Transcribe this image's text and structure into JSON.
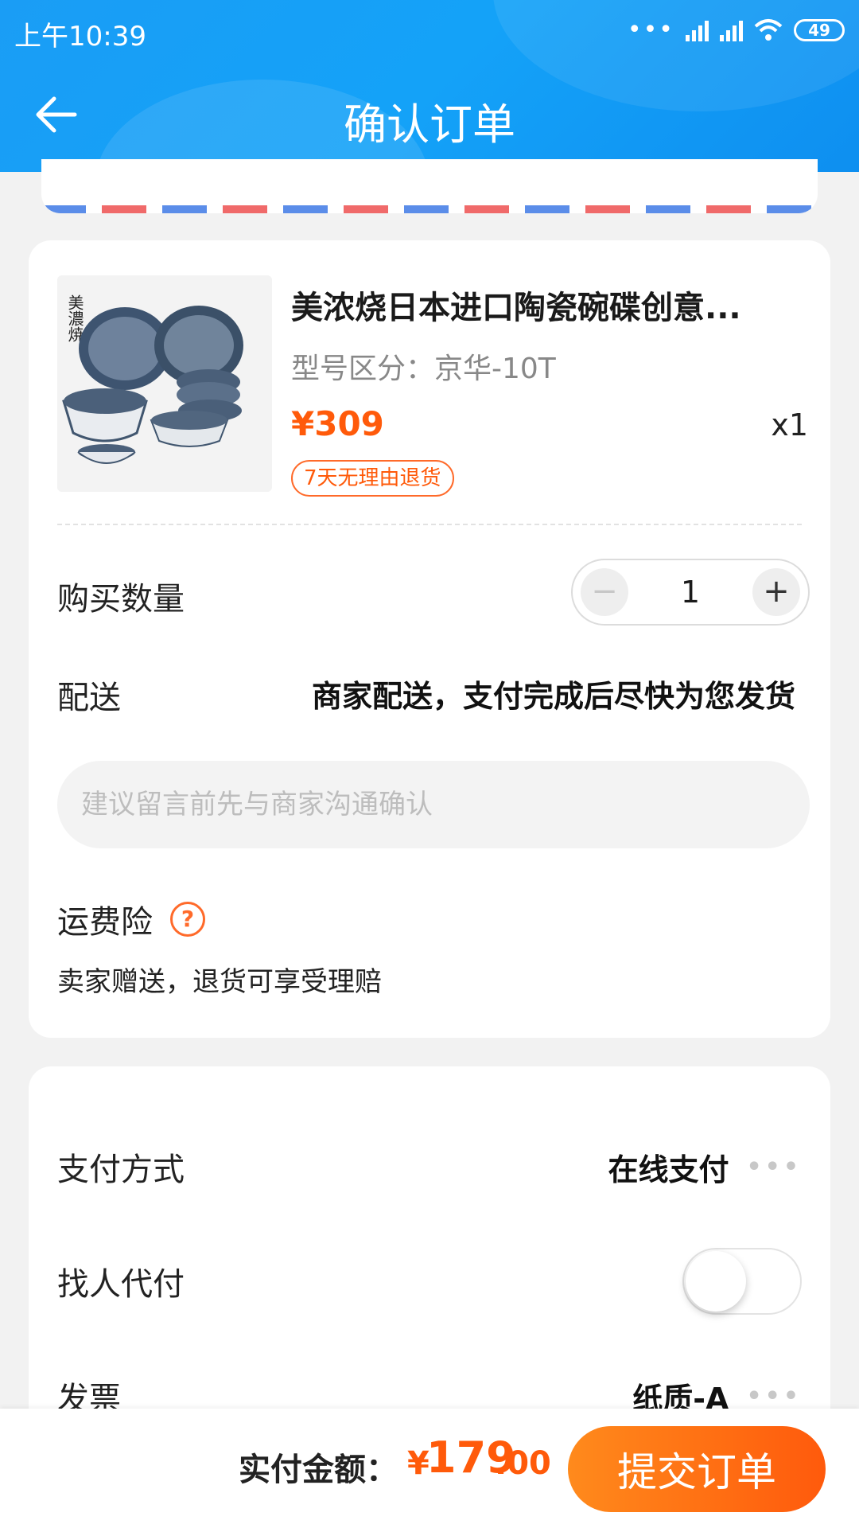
{
  "status_bar": {
    "time": "上午10:39",
    "battery": "49",
    "dots": "•••"
  },
  "header": {
    "title": "确认订单"
  },
  "product": {
    "title": "美浓烧日本进口陶瓷碗碟创意...",
    "model": "型号区分：京华-10T",
    "price": "¥309",
    "quantity": "x1",
    "badge": "7天无理由退货",
    "image_text": "美濃焼"
  },
  "purchase": {
    "label": "购买数量",
    "value": "1",
    "minus": "−",
    "plus": "+"
  },
  "delivery": {
    "label": "配送",
    "value": "商家配送，支付完成后尽快为您发货"
  },
  "message": {
    "placeholder": "建议留言前先与商家沟通确认",
    "value": ""
  },
  "insurance": {
    "label": "运费险",
    "help_icon": "?",
    "desc": "卖家赠送，退货可享受理赔"
  },
  "payment": {
    "method_label": "支付方式",
    "method_value": "在线支付",
    "proxy_label": "找人代付",
    "proxy_enabled": false,
    "invoice_label": "发票",
    "invoice_value": "纸质-A",
    "more_dots": "•••"
  },
  "bottom": {
    "total_label": "实付金额：",
    "currency": "¥",
    "total_int": "179",
    "total_dec": ".00",
    "submit": "提交订单"
  },
  "colors": {
    "header": "#1a9df5",
    "accent": "#ff5a0a"
  }
}
